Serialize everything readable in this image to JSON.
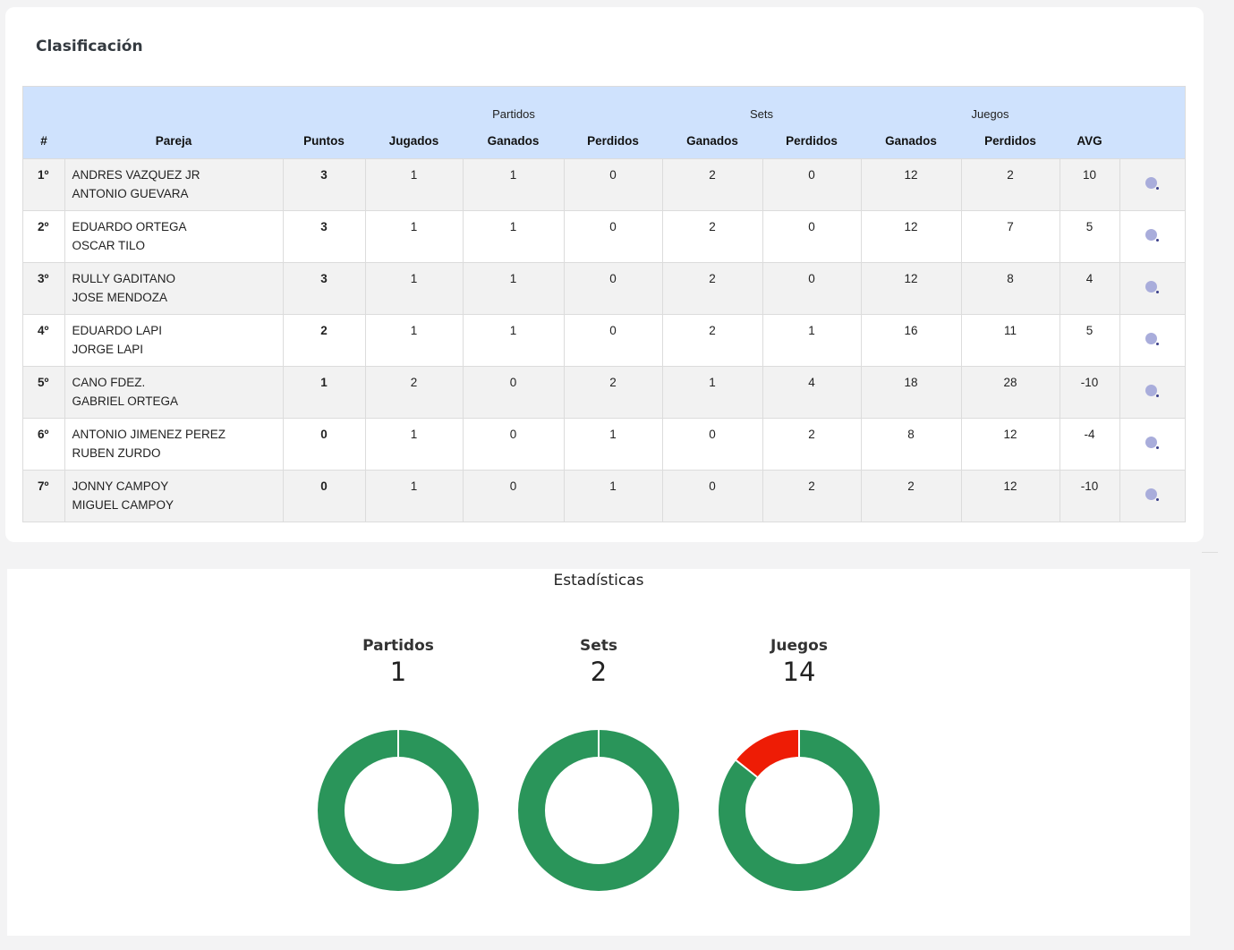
{
  "standings": {
    "title": "Clasificación",
    "groups": {
      "partidos": "Partidos",
      "sets": "Sets",
      "juegos": "Juegos"
    },
    "columns": {
      "rank": "#",
      "pair": "Pareja",
      "points": "Puntos",
      "played": "Jugados",
      "matches_won": "Ganados",
      "matches_lost": "Perdidos",
      "sets_won": "Ganados",
      "sets_lost": "Perdidos",
      "games_won": "Ganados",
      "games_lost": "Perdidos",
      "avg": "AVG"
    },
    "rows": [
      {
        "rank": "1º",
        "player1": "ANDRES VAZQUEZ JR",
        "player2": "ANTONIO GUEVARA",
        "points": "3",
        "played": "1",
        "matches_won": "1",
        "matches_lost": "0",
        "sets_won": "2",
        "sets_lost": "0",
        "games_won": "12",
        "games_lost": "2",
        "avg": "10"
      },
      {
        "rank": "2º",
        "player1": "EDUARDO ORTEGA",
        "player2": "OSCAR TILO",
        "points": "3",
        "played": "1",
        "matches_won": "1",
        "matches_lost": "0",
        "sets_won": "2",
        "sets_lost": "0",
        "games_won": "12",
        "games_lost": "7",
        "avg": "5"
      },
      {
        "rank": "3º",
        "player1": "RULLY GADITANO",
        "player2": "JOSE MENDOZA",
        "points": "3",
        "played": "1",
        "matches_won": "1",
        "matches_lost": "0",
        "sets_won": "2",
        "sets_lost": "0",
        "games_won": "12",
        "games_lost": "8",
        "avg": "4"
      },
      {
        "rank": "4º",
        "player1": "EDUARDO LAPI",
        "player2": "JORGE LAPI",
        "points": "2",
        "played": "1",
        "matches_won": "1",
        "matches_lost": "0",
        "sets_won": "2",
        "sets_lost": "1",
        "games_won": "16",
        "games_lost": "11",
        "avg": "5"
      },
      {
        "rank": "5º",
        "player1": "CANO FDEZ.",
        "player2": "GABRIEL ORTEGA",
        "points": "1",
        "played": "2",
        "matches_won": "0",
        "matches_lost": "2",
        "sets_won": "1",
        "sets_lost": "4",
        "games_won": "18",
        "games_lost": "28",
        "avg": "-10"
      },
      {
        "rank": "6º",
        "player1": "ANTONIO JIMENEZ PEREZ",
        "player2": "RUBEN ZURDO",
        "points": "0",
        "played": "1",
        "matches_won": "0",
        "matches_lost": "1",
        "sets_won": "0",
        "sets_lost": "2",
        "games_won": "8",
        "games_lost": "12",
        "avg": "-4"
      },
      {
        "rank": "7º",
        "player1": "JONNY CAMPOY",
        "player2": "MIGUEL CAMPOY",
        "points": "0",
        "played": "1",
        "matches_won": "0",
        "matches_lost": "1",
        "sets_won": "0",
        "sets_lost": "2",
        "games_won": "2",
        "games_lost": "12",
        "avg": "-10"
      }
    ],
    "row_icon": "user-stats-icon"
  },
  "stats": {
    "title": "Estadísticas",
    "colors": {
      "won": "#2a955a",
      "lost": "#ee1c05"
    },
    "charts": [
      {
        "label": "Partidos",
        "value": "1",
        "won_fraction": 1.0,
        "lost_fraction": 0.0
      },
      {
        "label": "Sets",
        "value": "2",
        "won_fraction": 1.0,
        "lost_fraction": 0.0
      },
      {
        "label": "Juegos",
        "value": "14",
        "won_fraction": 0.857,
        "lost_fraction": 0.143
      }
    ]
  }
}
